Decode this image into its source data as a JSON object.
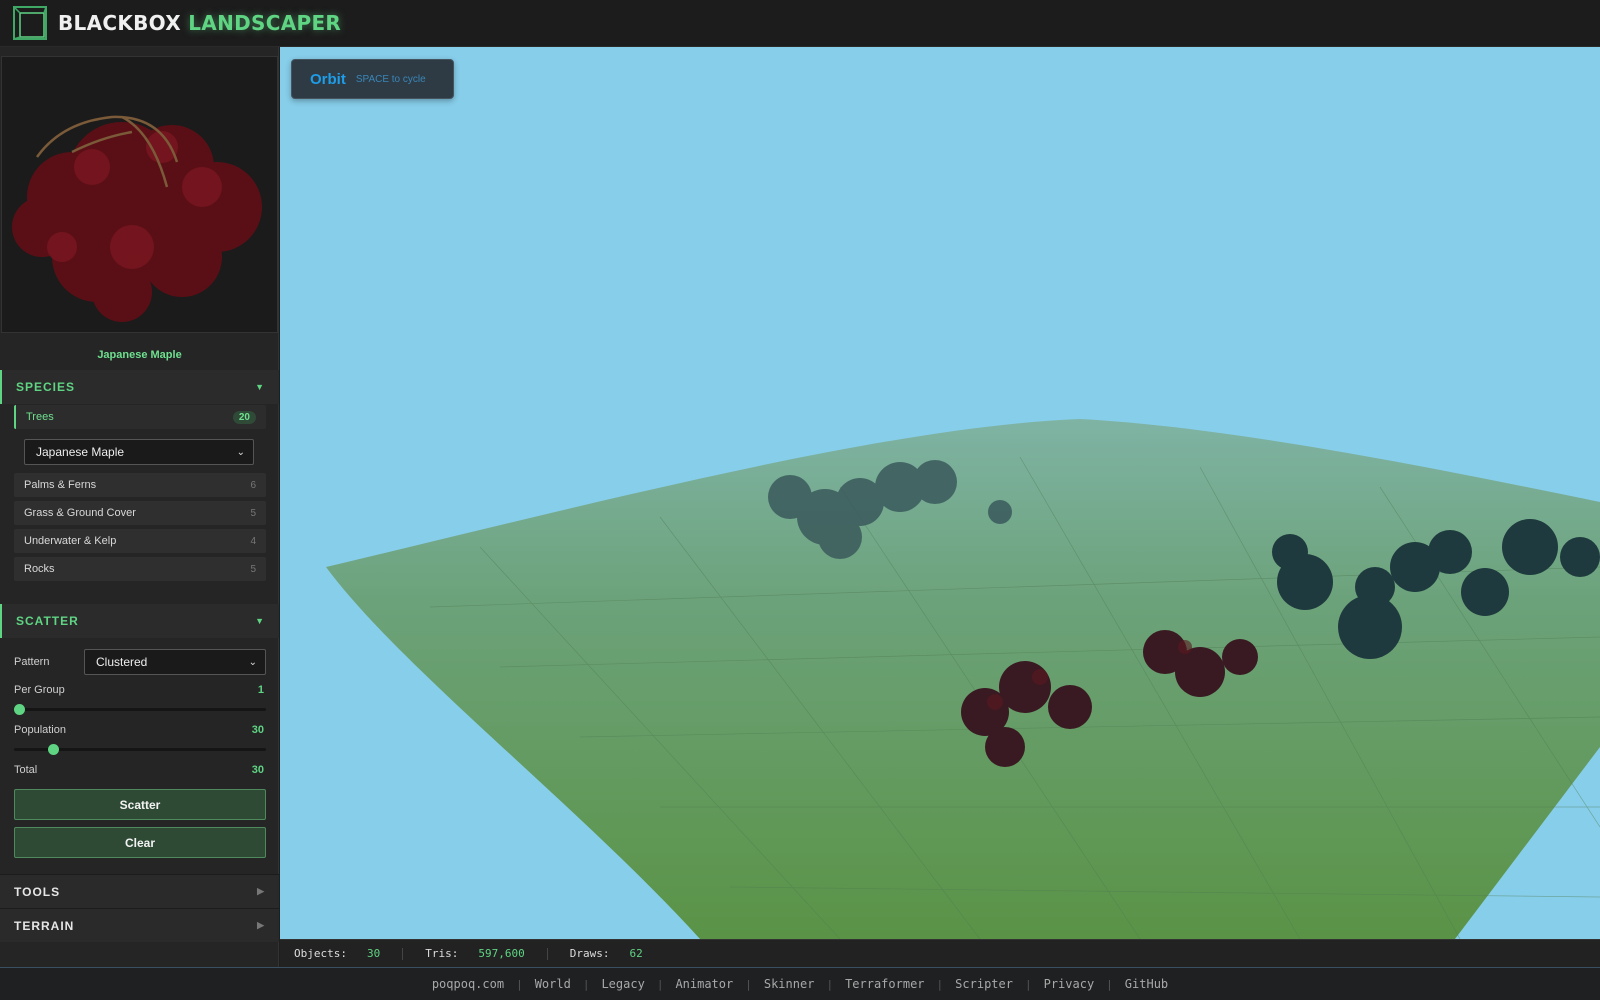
{
  "header": {
    "brand_white": "BLACKBOX",
    "brand_green": "LANDSCAPER",
    "logo_icon": "cube-icon",
    "accent_color": "#5fd483"
  },
  "preview": {
    "species_name": "Japanese Maple"
  },
  "species": {
    "title": "SPECIES",
    "categories": [
      {
        "label": "Trees",
        "count": "20"
      },
      {
        "label": "Palms & Ferns",
        "count": "6"
      },
      {
        "label": "Grass & Ground Cover",
        "count": "5"
      },
      {
        "label": "Underwater & Kelp",
        "count": "4"
      },
      {
        "label": "Rocks",
        "count": "5"
      }
    ],
    "selected": "Japanese Maple"
  },
  "scatter": {
    "title": "SCATTER",
    "pattern_label": "Pattern",
    "pattern_value": "Clustered",
    "per_group_label": "Per Group",
    "per_group_value": "1",
    "per_group_fraction": 0.0,
    "population_label": "Population",
    "population_value": "30",
    "population_fraction": 0.14,
    "total_label": "Total",
    "total_value": "30",
    "scatter_button": "Scatter",
    "clear_button": "Clear"
  },
  "tools": {
    "title": "TOOLS"
  },
  "terrain": {
    "title": "TERRAIN"
  },
  "viewport": {
    "mode": "Orbit",
    "hint": "SPACE to cycle",
    "sky_color": "#87ceea"
  },
  "stats": {
    "objects_label": "Objects:",
    "objects_value": "30",
    "tris_label": "Tris:",
    "tris_value": "597,600",
    "draws_label": "Draws:",
    "draws_value": "62"
  },
  "footer": {
    "links": [
      "poqpoq.com",
      "World",
      "Legacy",
      "Animator",
      "Skinner",
      "Terraformer",
      "Scripter",
      "Privacy",
      "GitHub"
    ]
  }
}
